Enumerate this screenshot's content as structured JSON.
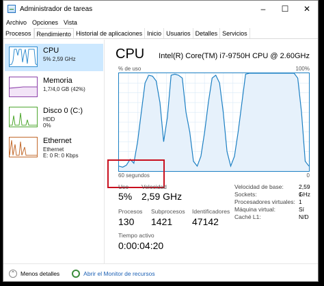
{
  "window": {
    "title": "Administrador de tareas"
  },
  "menu": [
    "Archivo",
    "Opciones",
    "Vista"
  ],
  "tabs": [
    "Procesos",
    "Rendimiento",
    "Historial de aplicaciones",
    "Inicio",
    "Usuarios",
    "Detalles",
    "Servicios"
  ],
  "active_tab": "Rendimiento",
  "sidebar": [
    {
      "name": "CPU",
      "line1": "5% 2,59 GHz",
      "line2": ""
    },
    {
      "name": "Memoria",
      "line1": "1,7/4,0 GB (42%)",
      "line2": ""
    },
    {
      "name": "Disco 0 (C:)",
      "line1": "HDD",
      "line2": "0%"
    },
    {
      "name": "Ethernet",
      "line1": "Ethernet",
      "line2": "E: 0 R: 0 Kbps"
    }
  ],
  "main": {
    "title": "CPU",
    "model": "Intel(R) Core(TM) i7-9750H CPU @ 2.60GHz",
    "y_label": "% de uso",
    "y_max": "100%",
    "time_label": "60 segundos",
    "y_min": "0"
  },
  "chart_data": {
    "type": "area",
    "xlabel": "60 segundos",
    "ylabel": "% de uso",
    "ylim": [
      0,
      100
    ],
    "series": [
      {
        "values": [
          5,
          4,
          6,
          12,
          8,
          30,
          60,
          90,
          98,
          97,
          92,
          70,
          30,
          55,
          98,
          99,
          98,
          95,
          60,
          40,
          10,
          5,
          15,
          40,
          70,
          95,
          98,
          90,
          60,
          20,
          5,
          15,
          40,
          70,
          99,
          100,
          100,
          100,
          100,
          100,
          100,
          100,
          100,
          100,
          100,
          100,
          100,
          100,
          95,
          60,
          10,
          5
        ]
      }
    ]
  },
  "stats": {
    "uso_label": "Uso",
    "uso_value": "5%",
    "velocidad_label": "Velocidad",
    "velocidad_value": "2,59 GHz",
    "procesos_label": "Procesos",
    "procesos_value": "130",
    "subprocesos_label": "Subprocesos",
    "subprocesos_value": "1421",
    "identificadores_label": "Identificadores",
    "identificadores_value": "47142",
    "tiempo_label": "Tiempo activo",
    "tiempo_value": "0:00:04:20"
  },
  "details": [
    {
      "label": "Velocidad de base:",
      "value": "2,59 GHz"
    },
    {
      "label": "Sockets:",
      "value": "1"
    },
    {
      "label": "Procesadores virtuales:",
      "value": "1"
    },
    {
      "label": "Máquina virtual:",
      "value": "Sí"
    },
    {
      "label": "Caché L1:",
      "value": "N/D"
    }
  ],
  "bottom": {
    "less_details": "Menos detalles",
    "resource_monitor": "Abrir el Monitor de recursos"
  }
}
